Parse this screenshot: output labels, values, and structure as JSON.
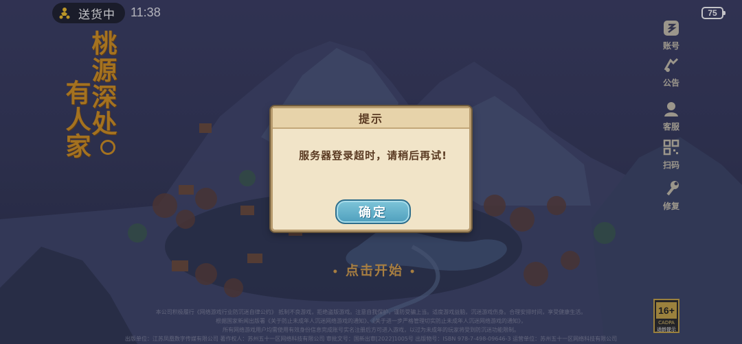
{
  "status_bar": {
    "activity": "送货中",
    "time": "11:38",
    "battery": "75",
    "activity_icon": "delivery-rider-icon"
  },
  "logo": {
    "line1": "桃源深处",
    "line2": "有人家",
    "color": "#d5921f"
  },
  "side_menu": [
    {
      "label": "账号",
      "icon": "account-icon"
    },
    {
      "label": "公告",
      "icon": "announcement-icon"
    },
    {
      "label": "客服",
      "icon": "customer-service-icon"
    },
    {
      "label": "扫码",
      "icon": "qr-scan-icon"
    },
    {
      "label": "修复",
      "icon": "repair-icon"
    }
  ],
  "dialog": {
    "title": "提示",
    "message": "服务器登录超时，请稍后再试!",
    "confirm_label": "确定",
    "button_color": "#5aa9c6"
  },
  "start_prompt": "点击开始",
  "footer": {
    "line1": "本公司积极履行《网络游戏行业防沉迷自律公约》  抵制不良游戏，拒绝盗版游戏。注意自我保护，谨防受骗上当。适度游戏益脑，沉迷游戏伤身。合理安排时间，享受健康生活。",
    "line2": "根据国家新闻出版署《关于防止未成年人沉迷网络游戏的通知》、《关于进一步严格管理切实防止未成年人沉迷网络游戏的通知》，",
    "line3": "所有网络游戏用户均需使用有效身份信息完成账号实名注册后方可进入游戏，以过为未成年的玩家将受到防沉迷功能限制。",
    "line4": "出版单位：江苏凤凰数字传媒有限公司    著作权人：苏州五十一区网络科技有限公司    审批文号：国新出审[2022]1005号    出版物号：ISBN 978-7-498-09646-3    运营单位：苏州五十一区网络科技有限公司"
  },
  "age_rating": {
    "value": "16+",
    "sub": "CADPA",
    "caption": "适龄提示"
  }
}
